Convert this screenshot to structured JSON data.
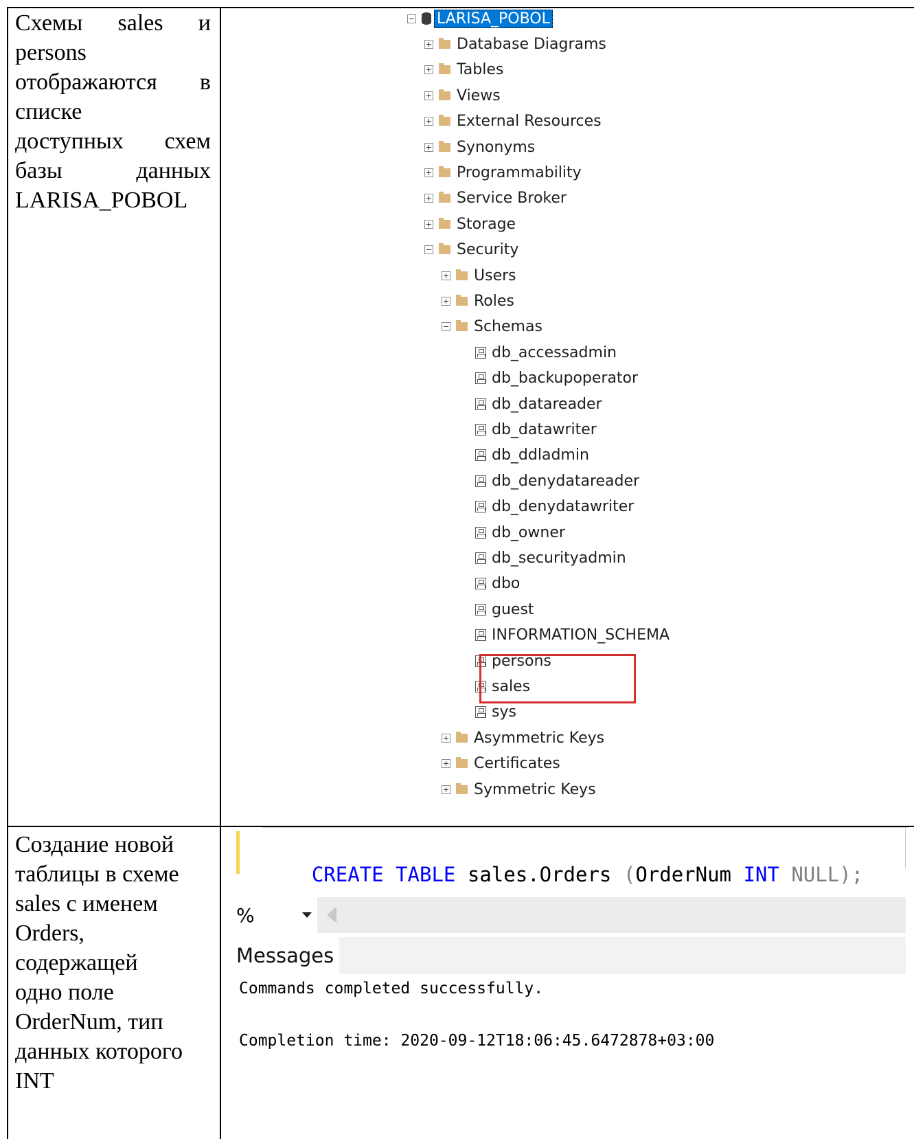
{
  "rows": [
    {
      "description": [
        "Схемы sales и",
        "persons",
        "отображаются в",
        "списке",
        "доступных схем",
        "базы данных",
        "LARISA_POBOL"
      ]
    },
    {
      "description": [
        "Создание новой",
        "таблицы в схеме",
        "sales с именем",
        "Orders,",
        "содержащей",
        "одно поле",
        "OrderNum, тип",
        "данных которого",
        "INT"
      ]
    }
  ],
  "tree": {
    "database": "LARISA_POBOL",
    "items": [
      {
        "label": "Database Diagrams",
        "level": 1,
        "state": "collapsed"
      },
      {
        "label": "Tables",
        "level": 1,
        "state": "collapsed"
      },
      {
        "label": "Views",
        "level": 1,
        "state": "collapsed"
      },
      {
        "label": "External Resources",
        "level": 1,
        "state": "collapsed"
      },
      {
        "label": "Synonyms",
        "level": 1,
        "state": "collapsed"
      },
      {
        "label": "Programmability",
        "level": 1,
        "state": "collapsed"
      },
      {
        "label": "Service Broker",
        "level": 1,
        "state": "collapsed"
      },
      {
        "label": "Storage",
        "level": 1,
        "state": "collapsed"
      },
      {
        "label": "Security",
        "level": 1,
        "state": "expanded"
      },
      {
        "label": "Users",
        "level": 2,
        "state": "collapsed"
      },
      {
        "label": "Roles",
        "level": 2,
        "state": "collapsed"
      },
      {
        "label": "Schemas",
        "level": 2,
        "state": "expanded"
      },
      {
        "label": "db_accessadmin",
        "level": 3,
        "state": "schema"
      },
      {
        "label": "db_backupoperator",
        "level": 3,
        "state": "schema"
      },
      {
        "label": "db_datareader",
        "level": 3,
        "state": "schema"
      },
      {
        "label": "db_datawriter",
        "level": 3,
        "state": "schema"
      },
      {
        "label": "db_ddladmin",
        "level": 3,
        "state": "schema"
      },
      {
        "label": "db_denydatareader",
        "level": 3,
        "state": "schema"
      },
      {
        "label": "db_denydatawriter",
        "level": 3,
        "state": "schema"
      },
      {
        "label": "db_owner",
        "level": 3,
        "state": "schema"
      },
      {
        "label": "db_securityadmin",
        "level": 3,
        "state": "schema"
      },
      {
        "label": "dbo",
        "level": 3,
        "state": "schema"
      },
      {
        "label": "guest",
        "level": 3,
        "state": "schema"
      },
      {
        "label": "INFORMATION_SCHEMA",
        "level": 3,
        "state": "schema"
      },
      {
        "label": "persons",
        "level": 3,
        "state": "schema"
      },
      {
        "label": "sales",
        "level": 3,
        "state": "schema"
      },
      {
        "label": "sys",
        "level": 3,
        "state": "schema"
      },
      {
        "label": "Asymmetric Keys",
        "level": 2,
        "state": "collapsed"
      },
      {
        "label": "Certificates",
        "level": 2,
        "state": "collapsed"
      },
      {
        "label": "Symmetric Keys",
        "level": 2,
        "state": "collapsed"
      }
    ]
  },
  "query": {
    "kw1": "CREATE",
    "kw2": "TABLE",
    "name": "sales.Orders",
    "paren_open": "(",
    "column": "OrderNum",
    "type": "INT",
    "nullability": "NULL",
    "tail": ");"
  },
  "results": {
    "zoom_label": "%",
    "tab_label": "Messages",
    "line1": "Commands completed successfully.",
    "line2": "Completion time: 2020-09-12T18:06:45.6472878+03:00"
  }
}
